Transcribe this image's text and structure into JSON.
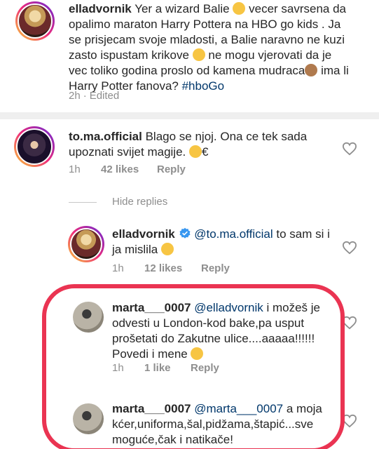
{
  "comments": [
    {
      "username": "elladvornik",
      "text_lines": [
        "Yer a wizard Balie",
        "vecer savrsena da",
        "opalimo maraton Harry Pottera na HBO go kids . Ja",
        "se prisjecam svoje mladosti, a Balie naravno ne kuzi",
        "zasto ispustam krikove",
        "ne mogu vjerovati da je",
        "vec toliko godina proslo od kamena mudraca",
        "ima li",
        "Harry Potter fanova?"
      ],
      "hashtag": "#hboGo",
      "time": "2h",
      "edited": "Edited"
    },
    {
      "username": "to.ma.official",
      "line1": "Blago se njoj. Ona ce tek sada",
      "line2": "upoznati svijet magije.",
      "line2_tail": "€",
      "time": "1h",
      "likes": "42 likes",
      "reply": "Reply"
    },
    {
      "username": "elladvornik",
      "mention": "@to.ma.official",
      "line1_tail": "to sam si i",
      "line2": "ja mislila",
      "time": "1h",
      "likes": "12 likes",
      "reply": "Reply"
    },
    {
      "username": "marta___0007",
      "mention": "@elladvornik",
      "line1_tail": "i možeš je",
      "line2": "odvesti u London-kod bake,pa usput",
      "line3": "prošetati do Zakutne ulice....aaaaa!!!!!!",
      "line4": "Povedi i mene",
      "time": "1h",
      "likes": "1 like",
      "reply": "Reply"
    },
    {
      "username": "marta___0007",
      "mention": "@marta___0007",
      "line1_tail": "a moja",
      "line2": "kćer,uniforma,šal,pidžama,štapić...sve",
      "line3": "moguće,čak i natikače!"
    }
  ],
  "hide_replies": "Hide replies",
  "colors": {
    "text": "#262626",
    "meta": "#8e8e8e",
    "link": "#00376b",
    "verified": "#3897f0",
    "highlight": "#ea3452"
  },
  "icons": [
    "heart-icon",
    "verified-badge-icon"
  ]
}
